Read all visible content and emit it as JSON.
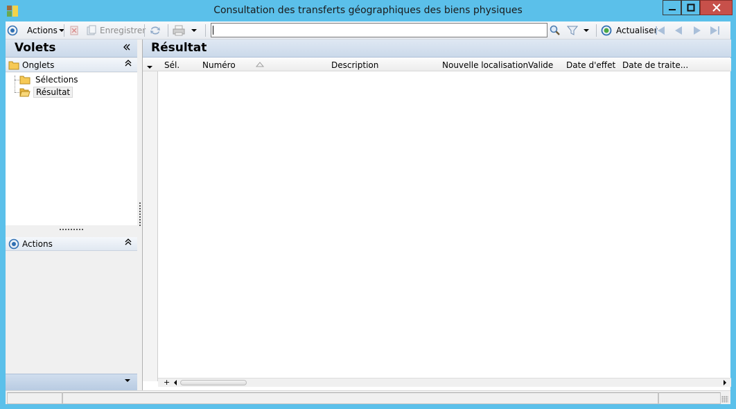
{
  "window": {
    "title": "Consultation des transferts géographiques des biens physiques",
    "controls": [
      "minimize-icon",
      "maximize-icon",
      "close-icon"
    ]
  },
  "toolbar": {
    "actions_label": "Actions",
    "save_label": "Enregistrer",
    "refresh_label": "Actualiser",
    "search_value": "",
    "icons": [
      "target-icon",
      "delete-icon",
      "save-icon",
      "sync-icon",
      "print-icon",
      "search-icon",
      "filter-icon",
      "refresh-icon",
      "first-icon",
      "prev-icon",
      "next-icon",
      "last-icon"
    ]
  },
  "left_panel": {
    "title": "Volets",
    "onglets": {
      "label": "Onglets",
      "items": [
        {
          "label": "Sélections"
        },
        {
          "label": "Résultat"
        }
      ]
    },
    "actions": {
      "label": "Actions"
    }
  },
  "right_panel": {
    "title": "Résultat",
    "columns": [
      "Sél.",
      "Numéro",
      "Description",
      "Nouvelle localisation",
      "Valide",
      "Date d'effet",
      "Date de traite..."
    ],
    "rows": []
  },
  "colors": {
    "window_frame": "#5bc0ea",
    "close_button": "#c7504a",
    "header_gradient": "#cbd9ea"
  }
}
